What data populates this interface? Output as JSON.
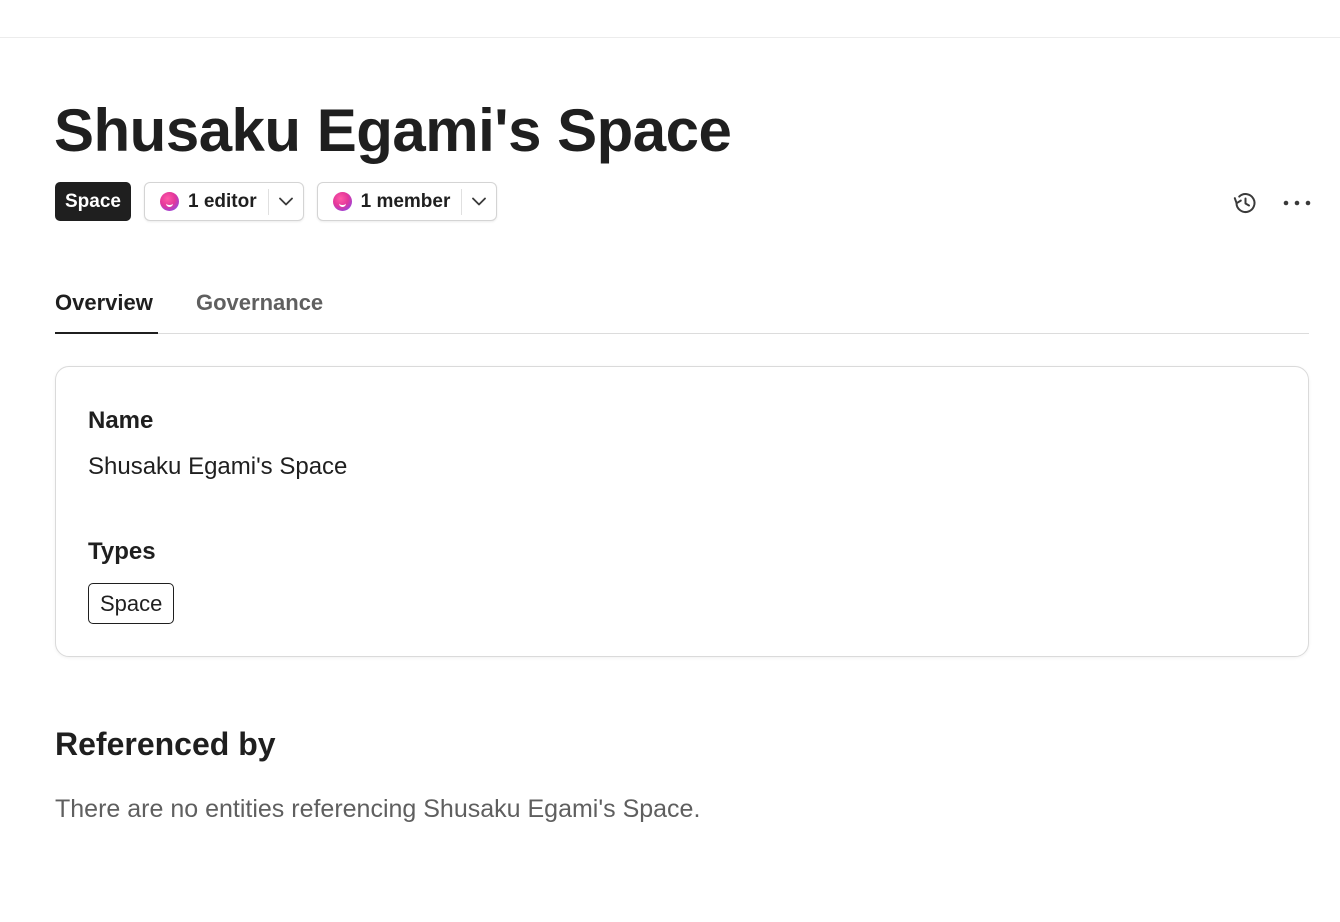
{
  "page": {
    "title": "Shusaku Egami's Space",
    "type_badge": "Space",
    "editors_label": "1 editor",
    "members_label": "1 member",
    "icons": {
      "history": "history-icon",
      "more": "more-horizontal-icon",
      "chevron": "chevron-down-icon",
      "avatar": "avatar-icon"
    }
  },
  "tabs": [
    {
      "label": "Overview",
      "active": true
    },
    {
      "label": "Governance",
      "active": false
    }
  ],
  "overview": {
    "name_label": "Name",
    "name_value": "Shusaku Egami's Space",
    "types_label": "Types",
    "types": [
      "Space"
    ]
  },
  "referenced_by": {
    "heading": "Referenced by",
    "empty_text": "There are no entities referencing Shusaku Egami's Space."
  },
  "colors": {
    "text": "#1f1f1f",
    "muted": "#5f5f5f",
    "border": "#dadada",
    "badge_bg": "#1f1f1f",
    "avatar_pink": "#e4379a",
    "avatar_purple": "#6d4bff"
  }
}
